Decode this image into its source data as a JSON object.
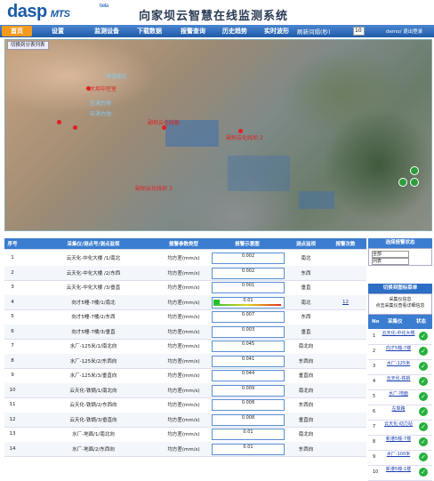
{
  "app": {
    "logo": "dasp",
    "logo_sub": "MTS",
    "beta": "beta",
    "title": "向家坝云智慧在线监测系统"
  },
  "nav": {
    "items": [
      "首页",
      "设置",
      "监测设备",
      "下载数据",
      "报警查询",
      "历史趋势",
      "实时波形"
    ],
    "refresh_label": "刷新间隔(秒)",
    "refresh_value": "10",
    "user": "demo/ 退出登录"
  },
  "map": {
    "toggle_label": "切换到分表列表",
    "labels": [
      "导流底孔",
      "大坝中控室",
      "左消力池",
      "右消力池",
      "副坝云化线板",
      "副坝云化线坝 2",
      "副坝云化线坝 3"
    ]
  },
  "table": {
    "headers": [
      "序号",
      "采集仪/测点号/测点监视",
      "报警参数类型",
      "报警示意图",
      "测点监视",
      "报警次数"
    ],
    "rows": [
      {
        "no": "1",
        "name": "云天化-中化大楼 /1/南北",
        "type": "均方差(mm/s)",
        "value": "0.002",
        "level": 0.0,
        "dir": "南北",
        "count": ""
      },
      {
        "no": "2",
        "name": "云天化-中化大楼 /2/东西",
        "type": "均方差(mm/s)",
        "value": "0.002",
        "level": 0.0,
        "dir": "东西",
        "count": ""
      },
      {
        "no": "3",
        "name": "云天化-中化大楼 /3/垂直",
        "type": "均方差(mm/s)",
        "value": "0.001",
        "level": 0.0,
        "dir": "垂直",
        "count": ""
      },
      {
        "no": "4",
        "name": "向才5幢-7楼/1/南北",
        "type": "均方差(mm/s)",
        "value": "0.01",
        "level": 0.09,
        "dir": "南北",
        "count": "12"
      },
      {
        "no": "5",
        "name": "向才5幢-7楼/2/东西",
        "type": "均方差(mm/s)",
        "value": "0.007",
        "level": 0.0,
        "dir": "东西",
        "count": ""
      },
      {
        "no": "6",
        "name": "向才5幢-7楼/3/垂直",
        "type": "均方差(mm/s)",
        "value": "0.003",
        "level": 0.0,
        "dir": "垂直",
        "count": ""
      },
      {
        "no": "7",
        "name": "水厂-125米/1/南北向",
        "type": "均方差(mm/s)",
        "value": "0.045",
        "level": 0.0,
        "dir": "南北向",
        "count": ""
      },
      {
        "no": "8",
        "name": "水厂-125米/2/东西向",
        "type": "均方差(mm/s)",
        "value": "0.041",
        "level": 0.0,
        "dir": "东西向",
        "count": ""
      },
      {
        "no": "9",
        "name": "水厂-125米/3/垂直向",
        "type": "均方差(mm/s)",
        "value": "0.044",
        "level": 0.0,
        "dir": "垂直向",
        "count": ""
      },
      {
        "no": "10",
        "name": "云天化-铁锅/1/南北向",
        "type": "均方差(mm/s)",
        "value": "0.009",
        "level": 0.0,
        "dir": "南北向",
        "count": ""
      },
      {
        "no": "11",
        "name": "云天化-铁锅/2/东西向",
        "type": "均方差(mm/s)",
        "value": "0.008",
        "level": 0.0,
        "dir": "东西向",
        "count": ""
      },
      {
        "no": "12",
        "name": "云天化-铁锅/3/垂直向",
        "type": "均方差(mm/s)",
        "value": "0.008",
        "level": 0.0,
        "dir": "垂直向",
        "count": ""
      },
      {
        "no": "13",
        "name": "水厂-地面/1/南北向",
        "type": "均方差(mm/s)",
        "value": "0.01",
        "level": 0.0,
        "dir": "南北向",
        "count": ""
      },
      {
        "no": "14",
        "name": "水厂-地面/2/东西向",
        "type": "均方差(mm/s)",
        "value": "0.01",
        "level": 0.0,
        "dir": "东西向",
        "count": ""
      }
    ]
  },
  "panel": {
    "alarm_header": "选择报警状态",
    "alarm_options": [
      "全部",
      "列表"
    ],
    "switch_header": "切换到图标菜单",
    "hint_line1": "采集仪信息",
    "hint_line2": "点击采集仪查看详细信息",
    "list_headers": [
      "No",
      "采集仪",
      "状态"
    ],
    "items": [
      {
        "no": "1",
        "name": "云天化-中化大楼"
      },
      {
        "no": "2",
        "name": "向才5幢-7楼"
      },
      {
        "no": "3",
        "name": "水厂-125米"
      },
      {
        "no": "4",
        "name": "云天化-铁锅"
      },
      {
        "no": "5",
        "name": "水厂-地面"
      },
      {
        "no": "6",
        "name": "左岸路"
      },
      {
        "no": "7",
        "name": "云天化-动力站"
      },
      {
        "no": "8",
        "name": "新港5幢-7楼"
      },
      {
        "no": "9",
        "name": "水厂-100米"
      },
      {
        "no": "10",
        "name": "新港5幢-1楼"
      }
    ]
  },
  "colors": {
    "nav": "#1f5aa8",
    "active": "#f39a1e",
    "header_row": "#3b7dd0",
    "ok": "#25b03b",
    "alarm_fill": "#22c02a"
  }
}
